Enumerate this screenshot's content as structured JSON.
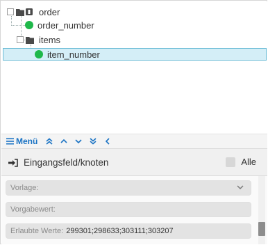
{
  "tree": {
    "items": [
      {
        "label": "order"
      },
      {
        "label": "order_number"
      },
      {
        "label": "items"
      },
      {
        "label": "item_number"
      }
    ]
  },
  "menubar": {
    "menu_label": "Menü"
  },
  "panel": {
    "title": "Eingangsfeld/knoten",
    "all_label": "Alle"
  },
  "fields": {
    "template_label": "Vorlage:",
    "default_label": "Vorgabewert:",
    "allowed_label": "Erlaubte Werte:",
    "allowed_value": "299301;298633;303111;303207"
  },
  "colors": {
    "accent": "#1a73c4",
    "selected_bg": "#d4eef7",
    "leaf_dot": "#1fb84a"
  }
}
